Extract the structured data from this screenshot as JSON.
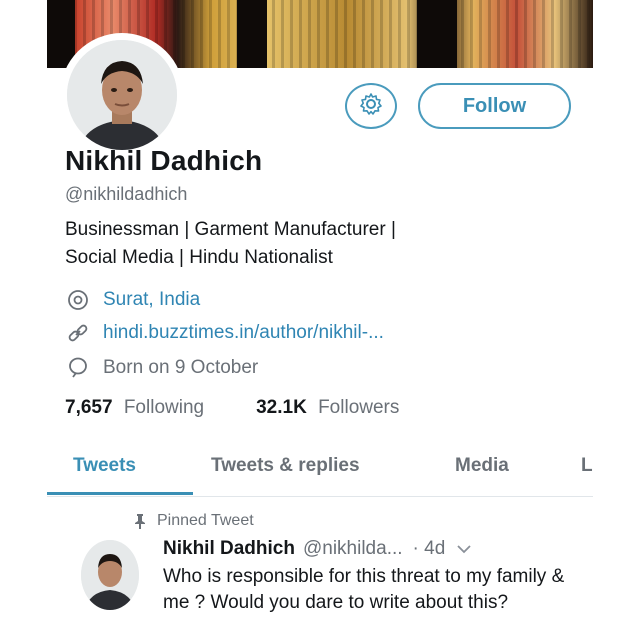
{
  "profile": {
    "name": "Nikhil Dadhich",
    "handle": "@nikhildadhich",
    "bio_line1": "Businessman | Garment Manufacturer |",
    "bio_line2": "Social Media | Hindu Nationalist",
    "location": "Surat, India",
    "website": "hindi.buzztimes.in/author/nikhil-...",
    "birthday": "Born on 9 October",
    "following_count": "7,657",
    "following_label": "Following",
    "followers_count": "32.1K",
    "followers_label": "Followers"
  },
  "actions": {
    "follow_label": "Follow"
  },
  "tabs": [
    {
      "label": "Tweets",
      "active": true
    },
    {
      "label": "Tweets & replies",
      "active": false
    },
    {
      "label": "Media",
      "active": false
    },
    {
      "label": "L",
      "active": false
    }
  ],
  "pinned_tweet": {
    "pinned_label": "Pinned Tweet",
    "author_name": "Nikhil Dadhich",
    "author_handle": "@nikhilda...",
    "time": "· 4d",
    "text": "Who is responsible for this threat to my family & me ? Would you dare to write about this?"
  },
  "colors": {
    "accent": "#3a8fb5",
    "border": "#4a9bbd",
    "muted": "#6a7077",
    "text": "#14171a"
  },
  "icons": {
    "settings": "gear-icon",
    "location": "location-pin-icon",
    "link": "link-icon",
    "birthday": "balloon-icon",
    "pin": "pin-icon",
    "menu": "chevron-down-icon"
  }
}
